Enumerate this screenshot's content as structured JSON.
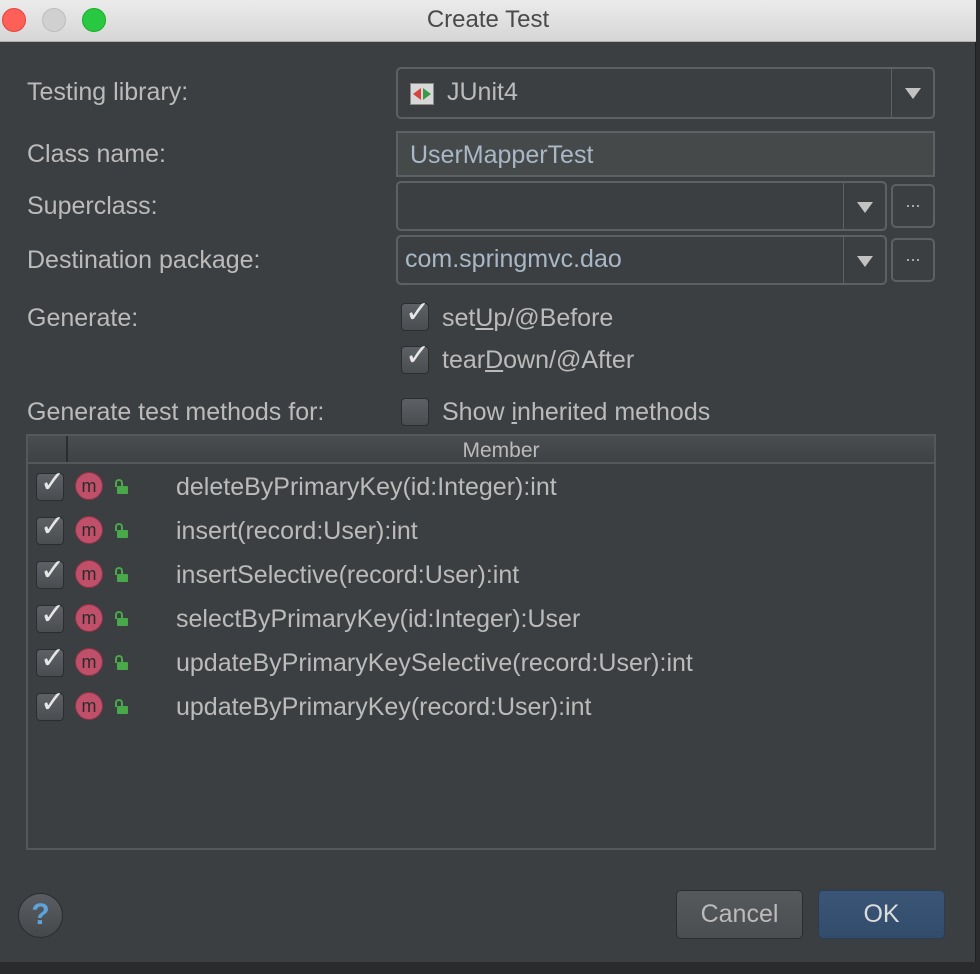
{
  "window": {
    "title": "Create Test"
  },
  "form": {
    "testing_library_label": "Testing library:",
    "testing_library_value": "JUnit4",
    "class_name_label": "Class name:",
    "class_name_value": "UserMapperTest",
    "superclass_label": "Superclass:",
    "superclass_value": "",
    "destination_package_label": "Destination package:",
    "destination_package_value": "com.springmvc.dao",
    "ellipsis_label": "...",
    "generate_label": "Generate:",
    "setup": {
      "pre": "set",
      "underline": "U",
      "post": "p/@Before",
      "checked": true
    },
    "teardown": {
      "pre": "tear",
      "underline": "D",
      "post": "own/@After",
      "checked": true
    },
    "generate_methods_label": "Generate test methods for:",
    "show_inherited": {
      "pre": "Show ",
      "underline": "i",
      "post": "nherited methods",
      "checked": false
    }
  },
  "table": {
    "column_header": "Member",
    "method_icon_letter": "m",
    "rows": [
      {
        "signature": "deleteByPrimaryKey(id:Integer):int",
        "checked": true
      },
      {
        "signature": "insert(record:User):int",
        "checked": true
      },
      {
        "signature": "insertSelective(record:User):int",
        "checked": true
      },
      {
        "signature": "selectByPrimaryKey(id:Integer):User",
        "checked": true
      },
      {
        "signature": "updateByPrimaryKeySelective(record:User):int",
        "checked": true
      },
      {
        "signature": "updateByPrimaryKey(record:User):int",
        "checked": true
      }
    ]
  },
  "buttons": {
    "help": "?",
    "cancel": "Cancel",
    "ok": "OK"
  },
  "icons": {
    "checkmark": "✓",
    "junit_icon": "junit-icon",
    "method_icon": "method-icon",
    "public_lock_icon": "unlocked-icon"
  },
  "colors": {
    "background": "#3c3f41",
    "text": "#bbbbbb",
    "value_text": "#a9b7c6",
    "method_icon": "#c0506a",
    "lock_icon": "#48a84a",
    "ok_button": "#365880"
  }
}
